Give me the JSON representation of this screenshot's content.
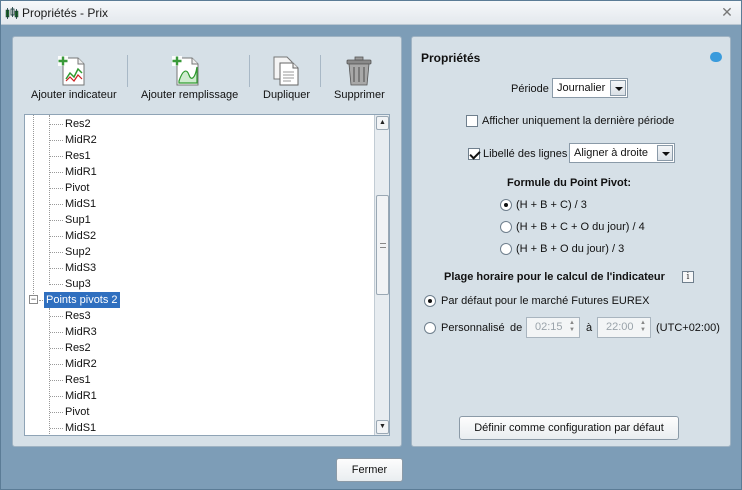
{
  "window": {
    "title": "Propriétés - Prix",
    "close_icon": "close-icon"
  },
  "toolbar": {
    "add_indicator": "Ajouter indicateur",
    "add_fill": "Ajouter remplissage",
    "duplicate": "Dupliquer",
    "delete": "Supprimer"
  },
  "tree": {
    "items": [
      {
        "label": "Res2",
        "level": 2
      },
      {
        "label": "MidR2",
        "level": 2
      },
      {
        "label": "Res1",
        "level": 2
      },
      {
        "label": "MidR1",
        "level": 2
      },
      {
        "label": "Pivot",
        "level": 2
      },
      {
        "label": "MidS1",
        "level": 2
      },
      {
        "label": "Sup1",
        "level": 2
      },
      {
        "label": "MidS2",
        "level": 2
      },
      {
        "label": "Sup2",
        "level": 2
      },
      {
        "label": "MidS3",
        "level": 2
      },
      {
        "label": "Sup3",
        "level": 2
      },
      {
        "label": "Points pivots 2",
        "level": 1,
        "expander": "−",
        "selected": true
      },
      {
        "label": "Res3",
        "level": 2
      },
      {
        "label": "MidR3",
        "level": 2
      },
      {
        "label": "Res2",
        "level": 2
      },
      {
        "label": "MidR2",
        "level": 2
      },
      {
        "label": "Res1",
        "level": 2
      },
      {
        "label": "MidR1",
        "level": 2
      },
      {
        "label": "Pivot",
        "level": 2
      },
      {
        "label": "MidS1",
        "level": 2
      }
    ]
  },
  "properties": {
    "title": "Propriétés",
    "period_label": "Période",
    "period_value": "Journalier",
    "only_last_period_label": "Afficher uniquement la dernière période",
    "only_last_period_checked": false,
    "line_labels_label": "Libellé des lignes",
    "line_labels_checked": true,
    "line_labels_value": "Aligner à droite",
    "formula_title": "Formule du Point Pivot:",
    "formula_options": [
      {
        "label": "(H + B + C) / 3",
        "checked": true
      },
      {
        "label": "(H + B + C + O du jour) / 4",
        "checked": false
      },
      {
        "label": "(H + B + O du jour) / 3",
        "checked": false
      }
    ],
    "time_range_title": "Plage horaire pour le calcul de l'indicateur",
    "info_glyph": "i",
    "default_market_label": "Par défaut pour le marché Futures EUREX",
    "custom_label": "Personnalisé",
    "from_label": "de",
    "from_time": "02:15",
    "to_label": "à",
    "to_time": "22:00",
    "timezone": "(UTC+02:00)",
    "set_default_button": "Définir comme configuration par défaut"
  },
  "footer": {
    "close_button": "Fermer"
  },
  "colors": {
    "selection": "#2f6fbf",
    "panel": "#d6e0e7",
    "frame": "#7d9db7"
  }
}
